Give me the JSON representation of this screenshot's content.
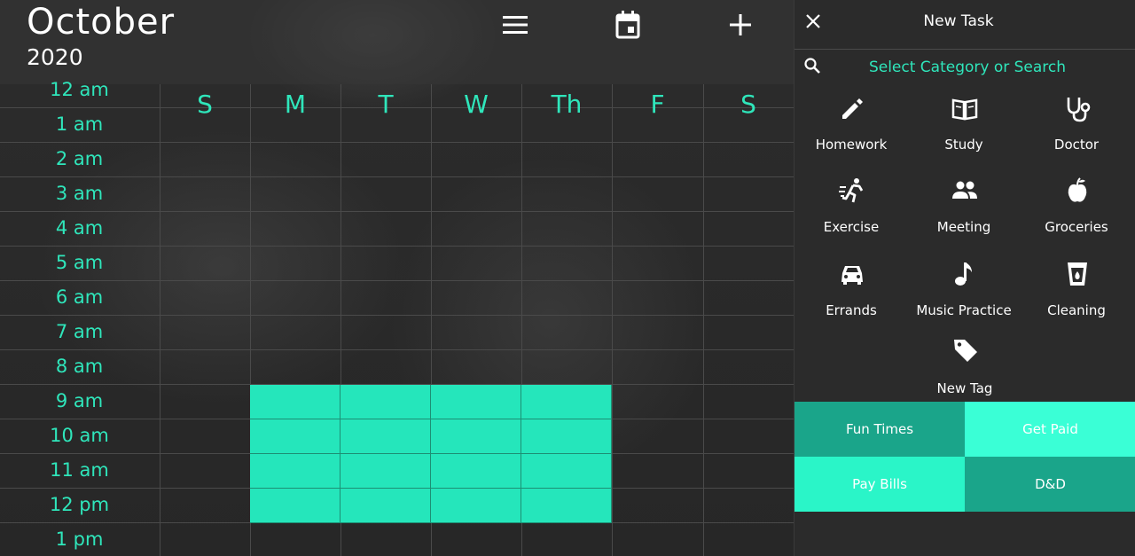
{
  "header": {
    "month": "October",
    "year": "2020",
    "menu_icon": "hamburger-menu-icon",
    "calendar_icon": "calendar-today-icon",
    "add_icon": "plus-icon"
  },
  "calendar": {
    "days": [
      "S",
      "M",
      "T",
      "W",
      "Th",
      "F",
      "S"
    ],
    "times": [
      "12 am",
      "1 am",
      "2 am",
      "3 am",
      "4 am",
      "5 am",
      "6 am",
      "7 am",
      "8 am",
      "9 am",
      "10 am",
      "11 am",
      "12 pm",
      "1 pm"
    ],
    "accent_color": "#2fe6bb",
    "event_color": "#25e6bb",
    "highlighted": {
      "days": [
        "M",
        "T",
        "W",
        "Th"
      ],
      "times": [
        "9 am",
        "10 am",
        "11 am",
        "12 pm"
      ]
    }
  },
  "panel": {
    "title": "New Task",
    "close_icon": "close-icon",
    "search_icon": "search-icon",
    "search_placeholder": "Select Category or Search",
    "categories": [
      {
        "label": "Homework",
        "icon": "pencil-icon"
      },
      {
        "label": "Study",
        "icon": "book-icon"
      },
      {
        "label": "Doctor",
        "icon": "stethoscope-icon"
      },
      {
        "label": "Exercise",
        "icon": "running-icon"
      },
      {
        "label": "Meeting",
        "icon": "people-icon"
      },
      {
        "label": "Groceries",
        "icon": "apple-icon"
      },
      {
        "label": "Errands",
        "icon": "car-icon"
      },
      {
        "label": "Music Practice",
        "icon": "music-note-icon"
      },
      {
        "label": "Cleaning",
        "icon": "cup-drop-icon"
      },
      {
        "label": "New Tag",
        "icon": "tag-icon"
      }
    ],
    "tags": [
      {
        "label": "Fun Times",
        "color": "#1aa58a"
      },
      {
        "label": "Get Paid",
        "color": "#3affd6"
      },
      {
        "label": "Pay Bills",
        "color": "#2af5c8"
      },
      {
        "label": "D&D",
        "color": "#1aa58a"
      }
    ]
  }
}
